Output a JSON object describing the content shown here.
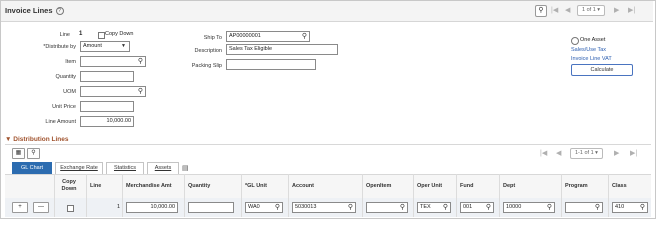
{
  "header": {
    "title": "Invoice Lines",
    "pager_text": "1 of 1"
  },
  "form": {
    "line_label": "Line",
    "line_value": "1",
    "copy_down_label": "Copy Down",
    "distribute_by_label": "*Distribute by",
    "distribute_by_value": "Amount",
    "item_label": "Item",
    "item_value": "",
    "quantity_label": "Quantity",
    "quantity_value": "",
    "uom_label": "UOM",
    "uom_value": "",
    "unit_price_label": "Unit Price",
    "unit_price_value": "",
    "line_amount_label": "Line Amount",
    "line_amount_value": "10,000.00",
    "ship_to_label": "Ship To",
    "ship_to_value": "AP00000001",
    "description_label": "Description",
    "description_value": "Sales Tax Eligible",
    "packing_slip_label": "Packing Slip",
    "packing_slip_value": ""
  },
  "right_panel": {
    "one_asset_label": "One Asset",
    "sales_use_tax_link": "Sales/Use Tax",
    "invoice_line_vat_link": "Invoice Line VAT",
    "calculate_button": "Calculate"
  },
  "distribution": {
    "section_title": "Distribution Lines",
    "pager_text": "1-1 of 1",
    "tabs": [
      {
        "label": "GL Chart",
        "active": true
      },
      {
        "label": "Exchange Rate",
        "active": false
      },
      {
        "label": "Statistics",
        "active": false
      },
      {
        "label": "Assets",
        "active": false
      }
    ],
    "columns": [
      "Copy Down",
      "Line",
      "Merchandise Amt",
      "Quantity",
      "*GL Unit",
      "Account",
      "OpenItem",
      "Oper Unit",
      "Fund",
      "Dept",
      "Program",
      "Class"
    ],
    "row": {
      "line": "1",
      "merchandise_amt": "10,000.00",
      "quantity": "",
      "gl_unit": "WA0",
      "account": "5030013",
      "open_item": "",
      "oper_unit": "TEX",
      "fund": "001",
      "dept": "10000",
      "program": "",
      "class": "410"
    }
  }
}
